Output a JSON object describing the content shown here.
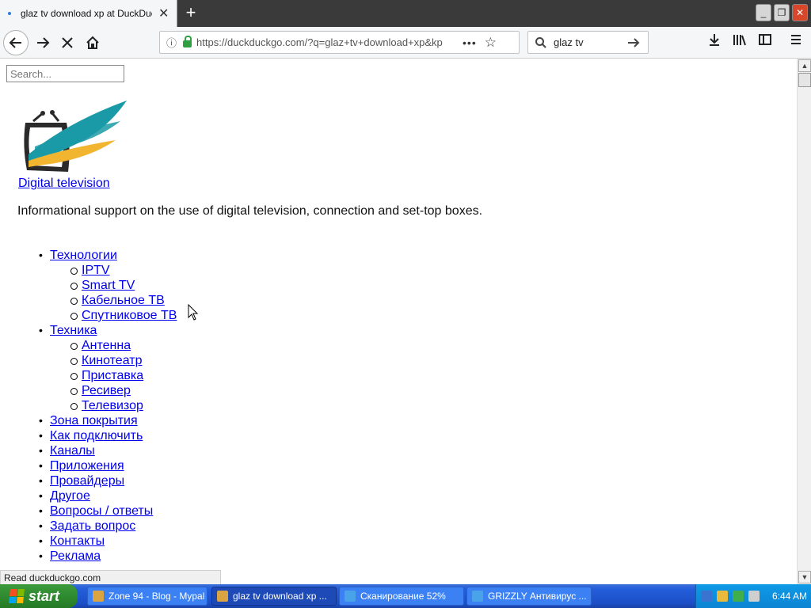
{
  "browser": {
    "tab_title": "glaz tv download xp at DuckDuckG",
    "tab_close": "✕",
    "new_tab": "+",
    "url": "https://duckduckgo.com/?q=glaz+tv+download+xp&kp",
    "search_value": "glaz tv",
    "status_text": "Read duckduckgo.com"
  },
  "page": {
    "search_placeholder": "Search...",
    "site_title": "Digital television",
    "tagline": "Informational support on the use of digital television, connection and set-top boxes.",
    "menu": [
      {
        "label": "Технологии",
        "children": [
          "IPTV",
          "Smart TV",
          "Кабельное ТВ",
          "Спутниковое ТВ"
        ]
      },
      {
        "label": "Техника",
        "children": [
          "Антенна",
          "Кинотеатр",
          "Приставка",
          "Ресивер",
          "Телевизор"
        ]
      },
      {
        "label": "Зона покрытия",
        "children": []
      },
      {
        "label": "Как подключить",
        "children": []
      },
      {
        "label": "Каналы",
        "children": []
      },
      {
        "label": "Приложения",
        "children": []
      },
      {
        "label": "Провайдеры",
        "children": []
      },
      {
        "label": "Другое",
        "children": []
      },
      {
        "label": "Вопросы / ответы",
        "children": []
      },
      {
        "label": "Задать вопрос",
        "children": []
      },
      {
        "label": "Контакты",
        "children": []
      },
      {
        "label": "Реклама",
        "children": []
      }
    ]
  },
  "taskbar": {
    "start_label": "start",
    "tasks": [
      {
        "label": "Zone 94 - Blog - Mypal",
        "active": false,
        "icon_color": "#d9a441"
      },
      {
        "label": "glaz tv download xp ...",
        "active": true,
        "icon_color": "#d9a441"
      },
      {
        "label": "Сканирование 52%",
        "active": false,
        "icon_color": "#4aa3e8"
      },
      {
        "label": "GRIZZLY Антивирус ...",
        "active": false,
        "icon_color": "#4aa3e8"
      }
    ],
    "clock": "6:44 AM"
  },
  "colors": {
    "link": "#0000ee",
    "logo_teal": "#1a9aa6",
    "logo_yellow": "#f2b530",
    "logo_dark": "#2a2a2a"
  }
}
